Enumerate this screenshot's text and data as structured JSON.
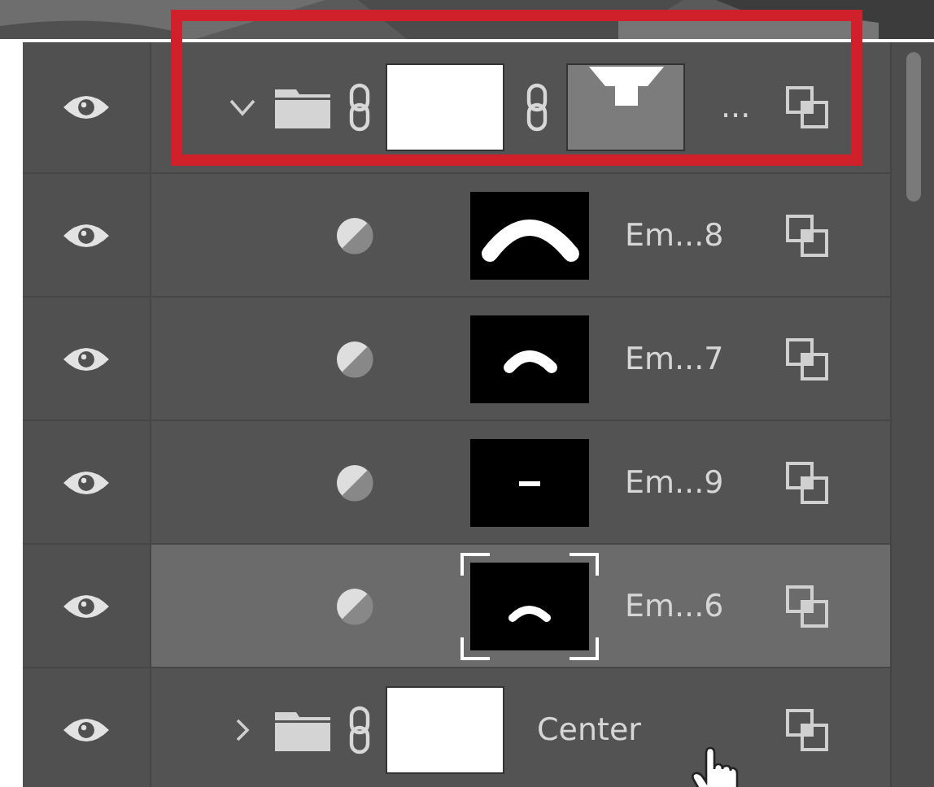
{
  "layers": [
    {
      "kind": "group",
      "visible": true,
      "expanded": true,
      "selected": false,
      "highlighted": true,
      "has_mask": true,
      "name": "..."
    },
    {
      "kind": "layer",
      "visible": true,
      "selected": false,
      "highlighted": false,
      "name": "Em...8"
    },
    {
      "kind": "layer",
      "visible": true,
      "selected": false,
      "highlighted": false,
      "name": "Em...7"
    },
    {
      "kind": "layer",
      "visible": true,
      "selected": false,
      "highlighted": false,
      "name": "Em...9"
    },
    {
      "kind": "layer",
      "visible": true,
      "selected": true,
      "highlighted": false,
      "name": "Em...6"
    },
    {
      "kind": "group",
      "visible": true,
      "expanded": false,
      "selected": false,
      "highlighted": false,
      "has_mask": false,
      "name": "Center"
    }
  ]
}
